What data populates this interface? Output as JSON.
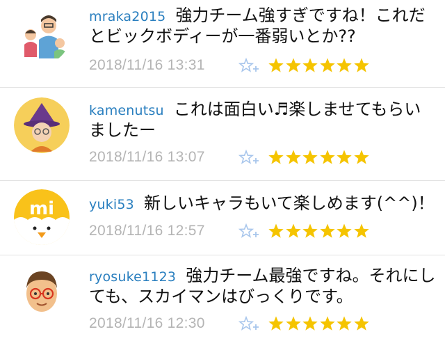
{
  "colors": {
    "username": "#2a7fbf",
    "timestamp": "#b4b4b4",
    "star": "#f5c400",
    "add_star_outline": "#a8c6ec"
  },
  "comments": [
    {
      "username": "mraka2015",
      "text": "強力チーム強すぎですね！これだとビックボディーが一番弱いとか??",
      "timestamp": "2018/11/16 13:31",
      "star_count": 6,
      "avatar_icon": "family-avatar-icon"
    },
    {
      "username": "kamenutsu",
      "text": "これは面白い♬楽しませてもらいましたー",
      "timestamp": "2018/11/16 13:07",
      "star_count": 6,
      "avatar_icon": "witch-avatar-icon"
    },
    {
      "username": "yuki53",
      "text": "新しいキャラもいて楽しめます(^^)！",
      "timestamp": "2018/11/16 12:57",
      "star_count": 6,
      "avatar_icon": "chick-avatar-icon"
    },
    {
      "username": "ryosuke1123",
      "text": "強力チーム最強ですね。それにしても、スカイマンはびっくりです。",
      "timestamp": "2018/11/16 12:30",
      "star_count": 6,
      "avatar_icon": "glasses-boy-avatar-icon"
    }
  ],
  "avatar_text": {
    "chick": "mi"
  }
}
